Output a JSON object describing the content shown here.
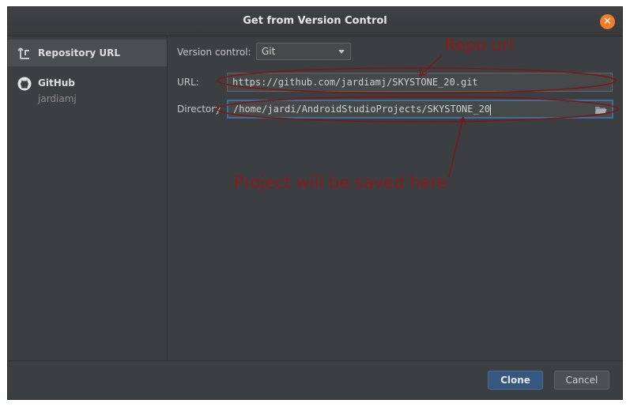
{
  "dialog": {
    "title": "Get from Version Control"
  },
  "sidebar": {
    "items": [
      {
        "label": "Repository URL",
        "icon": "repository-url-icon"
      },
      {
        "label": "GitHub",
        "sublabel": "jardiamj",
        "icon": "github-icon"
      }
    ]
  },
  "form": {
    "version_control_label": "Version control:",
    "version_control_value": "Git",
    "url_label": "URL:",
    "url_value": "https://github.com/jardiamj/SKYSTONE_20.git",
    "directory_label": "Directory",
    "directory_value": "/home/jardi/AndroidStudioProjects/SKYSTONE_20"
  },
  "footer": {
    "clone_label": "Clone",
    "cancel_label": "Cancel"
  },
  "annotations": {
    "repo_note": "Repo url",
    "dir_note": "Project will be saved here"
  },
  "colors": {
    "annotation": "#8b1a1a",
    "accent_close": "#ef7d2a",
    "primary_button": "#365880",
    "focus_border": "#3e6f9c"
  }
}
